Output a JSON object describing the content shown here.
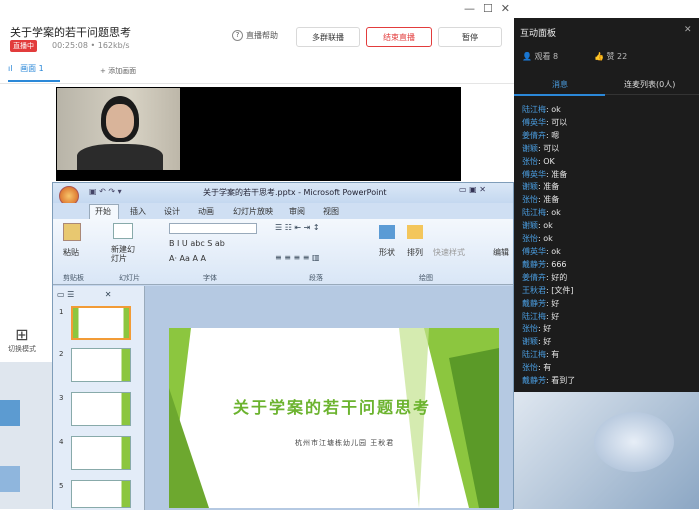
{
  "live": {
    "title": "关于学案的若干问题思考",
    "badge": "直播中",
    "elapsed": "00:25:08",
    "bitrate": "162kb/s",
    "help": "直播帮助",
    "buttons": {
      "link": "多群联播",
      "pause": "结束直播",
      "stop": "暂停"
    },
    "scene_tab": "画面 1",
    "add_scene": "添加画面",
    "switch_mode": "切换模式"
  },
  "ppt": {
    "window_title": "关于学案的若干思考.pptx - Microsoft PowerPoint",
    "tabs": [
      "开始",
      "插入",
      "设计",
      "动画",
      "幻灯片放映",
      "审阅",
      "视图"
    ],
    "groups": [
      "剪贴板",
      "幻灯片",
      "字体",
      "段落",
      "绘图",
      "编辑"
    ],
    "clipboard_btn": "粘贴",
    "newslide_btn": "新建幻灯片",
    "shape_btn": "形状",
    "arrange_btn": "排列",
    "quickstyle_btn": "快速样式",
    "edit_btn": "编辑",
    "thumbs": [
      "1",
      "2",
      "3",
      "4",
      "5"
    ],
    "slide_title": "关于学案的若干问题思考",
    "slide_sub": "杭州市江塘栋幼儿园 王秋君"
  },
  "panel": {
    "title": "互动面板",
    "viewers": "观看 8",
    "likes": "赞 22",
    "tabs": [
      "消息",
      "连麦列表(0人)"
    ],
    "messages": [
      {
        "u": "陆江梅",
        "t": "ok"
      },
      {
        "u": "傅英华",
        "t": "可以"
      },
      {
        "u": "姜倩卉",
        "t": "嗯"
      },
      {
        "u": "谢颖",
        "t": "可以"
      },
      {
        "u": "张怡",
        "t": "OK"
      },
      {
        "u": "傅英华",
        "t": "准备"
      },
      {
        "u": "谢颖",
        "t": "准备"
      },
      {
        "u": "张怡",
        "t": "准备"
      },
      {
        "u": "陆江梅",
        "t": "ok"
      },
      {
        "u": "谢颖",
        "t": "ok"
      },
      {
        "u": "张怡",
        "t": "ok"
      },
      {
        "u": "傅英华",
        "t": "ok"
      },
      {
        "u": "戴静芳",
        "t": "666"
      },
      {
        "u": "姜倩卉",
        "t": "好的"
      },
      {
        "u": "王秋君",
        "t": "[文件]"
      },
      {
        "u": "戴静芳",
        "t": "好"
      },
      {
        "u": "陆江梅",
        "t": "好"
      },
      {
        "u": "张怡",
        "t": "好"
      },
      {
        "u": "谢颖",
        "t": "好"
      },
      {
        "u": "陆江梅",
        "t": "有"
      },
      {
        "u": "张怡",
        "t": "有"
      },
      {
        "u": "戴静芳",
        "t": "看到了"
      }
    ]
  },
  "colors": {
    "accent": "#2b88d8",
    "live_red": "#e23c3c",
    "slide_green": "#8cc63f",
    "title_green": "#6bb32e"
  }
}
